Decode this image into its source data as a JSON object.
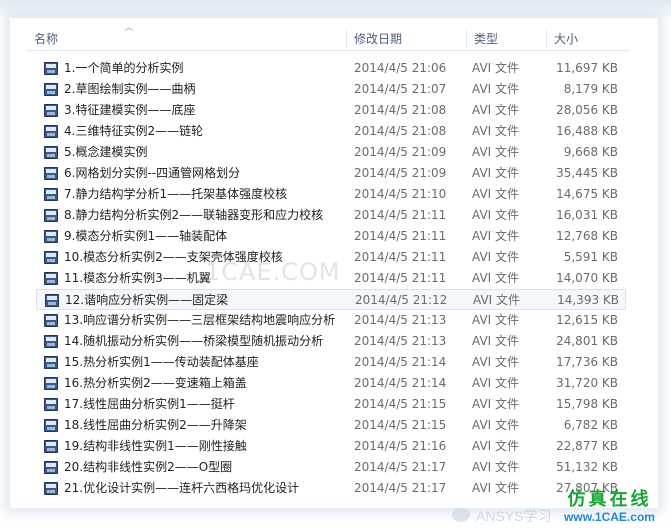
{
  "columns": {
    "name": "名称",
    "date": "修改日期",
    "type": "类型",
    "size": "大小"
  },
  "files": [
    {
      "name": "1.一个简单的分析实例",
      "date": "2014/4/5 21:06",
      "type": "AVI 文件",
      "size": "11,697 KB",
      "icon": "avi-file-icon"
    },
    {
      "name": "2.草图绘制实例——曲柄",
      "date": "2014/4/5 21:07",
      "type": "AVI 文件",
      "size": "8,179 KB",
      "icon": "avi-file-icon"
    },
    {
      "name": "3.特征建模实例——底座",
      "date": "2014/4/5 21:08",
      "type": "AVI 文件",
      "size": "28,056 KB",
      "icon": "avi-file-icon"
    },
    {
      "name": "4.三维特征实例2——链轮",
      "date": "2014/4/5 21:08",
      "type": "AVI 文件",
      "size": "16,488 KB",
      "icon": "avi-file-icon"
    },
    {
      "name": "5.概念建模实例",
      "date": "2014/4/5 21:09",
      "type": "AVI 文件",
      "size": "9,668 KB",
      "icon": "avi-file-icon"
    },
    {
      "name": "6.网格划分实例--四通管网格划分",
      "date": "2014/4/5 21:09",
      "type": "AVI 文件",
      "size": "35,445 KB",
      "icon": "avi-file-icon"
    },
    {
      "name": "7.静力结构学分析1——托架基体强度校核",
      "date": "2014/4/5 21:10",
      "type": "AVI 文件",
      "size": "14,675 KB",
      "icon": "avi-file-icon"
    },
    {
      "name": "8.静力结构分析实例2——联轴器变形和应力校核",
      "date": "2014/4/5 21:11",
      "type": "AVI 文件",
      "size": "16,031 KB",
      "icon": "avi-file-icon"
    },
    {
      "name": "9.模态分析实例1——轴装配体",
      "date": "2014/4/5 21:11",
      "type": "AVI 文件",
      "size": "12,768 KB",
      "icon": "avi-file-icon"
    },
    {
      "name": "10.模态分析实例2——支架壳体强度校核",
      "date": "2014/4/5 21:11",
      "type": "AVI 文件",
      "size": "5,591 KB",
      "icon": "avi-file-icon"
    },
    {
      "name": "11.模态分析实例3——机翼",
      "date": "2014/4/5 21:11",
      "type": "AVI 文件",
      "size": "14,070 KB",
      "icon": "avi-file-icon"
    },
    {
      "name": "12.谐响应分析实例——固定梁",
      "date": "2014/4/5 21:12",
      "type": "AVI 文件",
      "size": "14,393 KB",
      "icon": "avi-file-icon"
    },
    {
      "name": "13.响应谱分析实例——三层框架结构地震响应分析",
      "date": "2014/4/5 21:13",
      "type": "AVI 文件",
      "size": "12,615 KB",
      "icon": "avi-file-icon"
    },
    {
      "name": "14.随机振动分析实例——桥梁模型随机振动分析",
      "date": "2014/4/5 21:13",
      "type": "AVI 文件",
      "size": "24,801 KB",
      "icon": "avi-file-icon"
    },
    {
      "name": "15.热分析实例1——传动装配体基座",
      "date": "2014/4/5 21:14",
      "type": "AVI 文件",
      "size": "17,736 KB",
      "icon": "avi-file-icon"
    },
    {
      "name": "16.热分析实例2——变速箱上箱盖",
      "date": "2014/4/5 21:14",
      "type": "AVI 文件",
      "size": "31,720 KB",
      "icon": "avi-file-icon"
    },
    {
      "name": "17.线性屈曲分析实例1——挺杆",
      "date": "2014/4/5 21:15",
      "type": "AVI 文件",
      "size": "15,798 KB",
      "icon": "avi-file-icon"
    },
    {
      "name": "18.线性屈曲分析实例2——升降架",
      "date": "2014/4/5 21:15",
      "type": "AVI 文件",
      "size": "6,782 KB",
      "icon": "avi-file-icon"
    },
    {
      "name": "19.结构非线性实例1——刚性接触",
      "date": "2014/4/5 21:16",
      "type": "AVI 文件",
      "size": "22,877 KB",
      "icon": "avi-file-icon"
    },
    {
      "name": "20.结构非线性实例2——O型圈",
      "date": "2014/4/5 21:17",
      "type": "AVI 文件",
      "size": "51,132 KB",
      "icon": "avi-file-icon"
    },
    {
      "name": "21.优化设计实例——连杆六西格玛优化设计",
      "date": "2014/4/5 21:17",
      "type": "AVI 文件",
      "size": "27,807 KB",
      "icon": "avi-file-icon"
    }
  ],
  "watermark": "1CAE.COM",
  "footer_text": "ANSYS学习",
  "brand": {
    "title": "仿真在线",
    "url": "www.1CAE.com"
  },
  "selected_index": 11
}
